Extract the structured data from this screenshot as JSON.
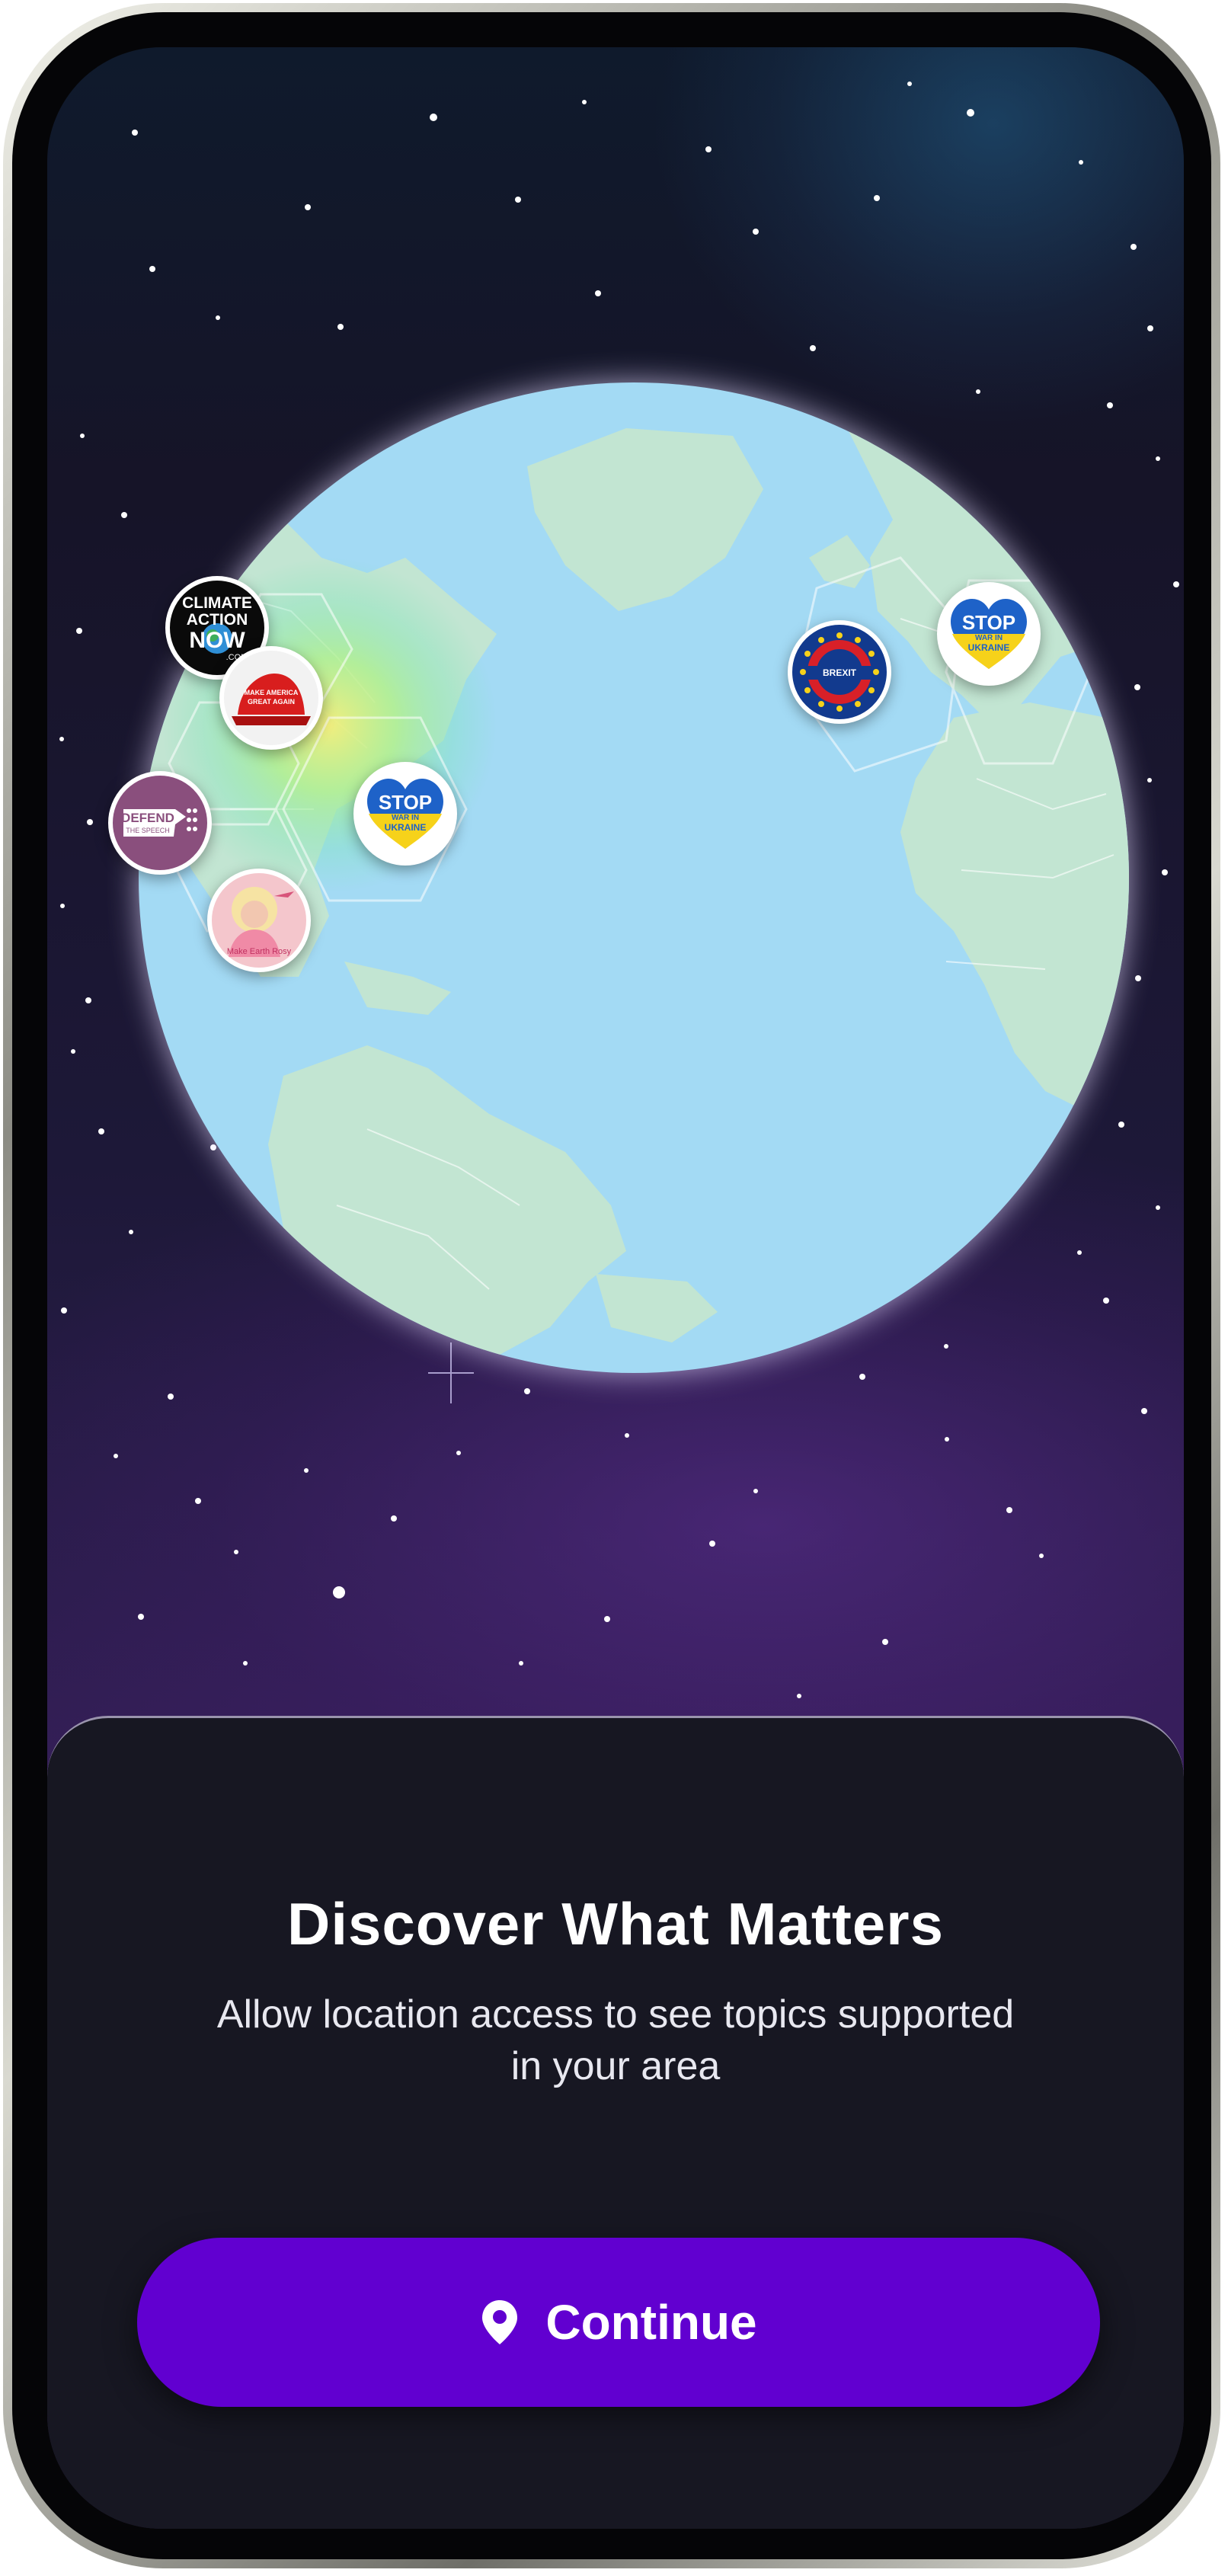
{
  "onboarding": {
    "title": "Discover What Matters",
    "subtitle": "Allow location access to see topics supported in your area",
    "continue_label": "Continue"
  },
  "map_pins": [
    {
      "name": "Climate Action Now",
      "text": [
        "CLIMATE",
        "ACTION",
        "NOW",
        ".COM"
      ]
    },
    {
      "name": "Make America Great Again",
      "text": [
        "MAKE AMERICA",
        "GREAT AGAIN"
      ]
    },
    {
      "name": "Defend the Speech",
      "text": [
        "DEFEND",
        "THE SPEECH"
      ]
    },
    {
      "name": "Stop War in Ukraine (Americas)",
      "text": [
        "STOP",
        "WAR IN",
        "UKRAINE"
      ]
    },
    {
      "name": "Portrait pin",
      "text": [
        "Make Earth Rosy"
      ]
    },
    {
      "name": "Brexit",
      "text": [
        "BREXIT"
      ]
    },
    {
      "name": "Stop War in Ukraine (Europe)",
      "text": [
        "STOP",
        "WAR IN",
        "UKRAINE"
      ]
    }
  ],
  "colors": {
    "accent": "#6100d0",
    "sheet": "#171722",
    "ocean": "#a3daf4",
    "land": "#c2e5d2"
  },
  "icons": {
    "continue": "location-pin-icon"
  }
}
